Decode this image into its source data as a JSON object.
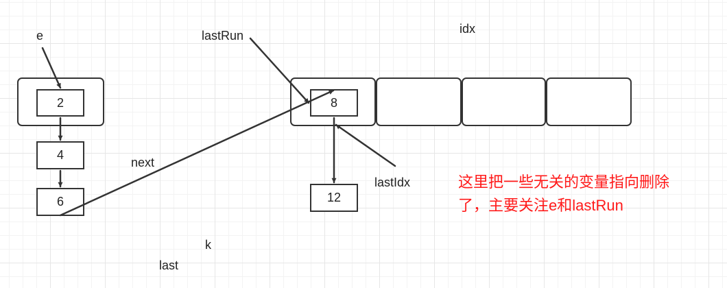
{
  "labels": {
    "e": "e",
    "lastRun": "lastRun",
    "idx": "idx",
    "next": "next",
    "lastIdx": "lastIdx",
    "k": "k",
    "last": "last"
  },
  "nodes": {
    "chain_head": "2",
    "chain_second": "4",
    "chain_third": "6",
    "table_slot0": "8",
    "slot0_next": "12"
  },
  "note": {
    "line1": "这里把一些无关的变量指向删除",
    "line2": "了，主要关注e和lastRun"
  },
  "colors": {
    "note": "#ff1a1a",
    "stroke": "#333333"
  }
}
